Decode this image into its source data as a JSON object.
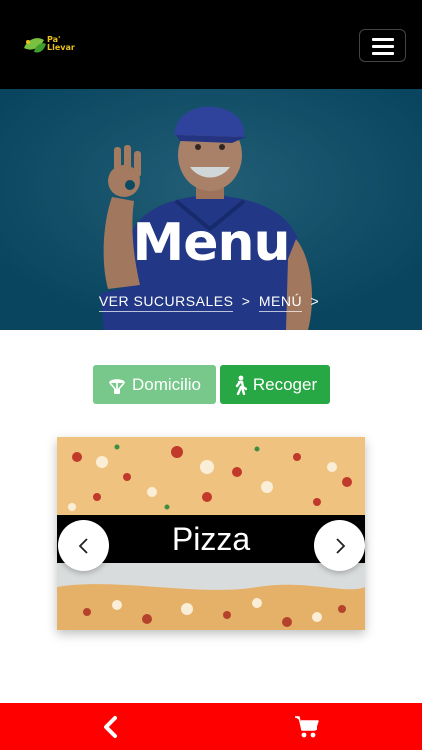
{
  "header": {
    "logo_line1": "Pa'",
    "logo_line2": "Llevar",
    "menu_icon": "hamburger-icon"
  },
  "hero": {
    "title": "Menu",
    "breadcrumb": [
      {
        "label": "VER SUCURSALES"
      },
      {
        "label": "MENÚ"
      }
    ],
    "separator": ">",
    "bg_color": "#0a5773"
  },
  "order_options": {
    "domicilio_label": "Domicilio",
    "domicilio_icon": "parachute-icon",
    "domicilio_color": "#77c88a",
    "recoger_label": "Recoger",
    "recoger_icon": "walking-person-icon",
    "recoger_color": "#28a745"
  },
  "carousel": {
    "caption": "Pizza",
    "prev_icon": "chevron-left-icon",
    "next_icon": "chevron-right-icon"
  },
  "bottom_bar": {
    "color": "#ff0000",
    "back_icon": "chevron-left-icon",
    "cart_icon": "shopping-cart-icon"
  }
}
